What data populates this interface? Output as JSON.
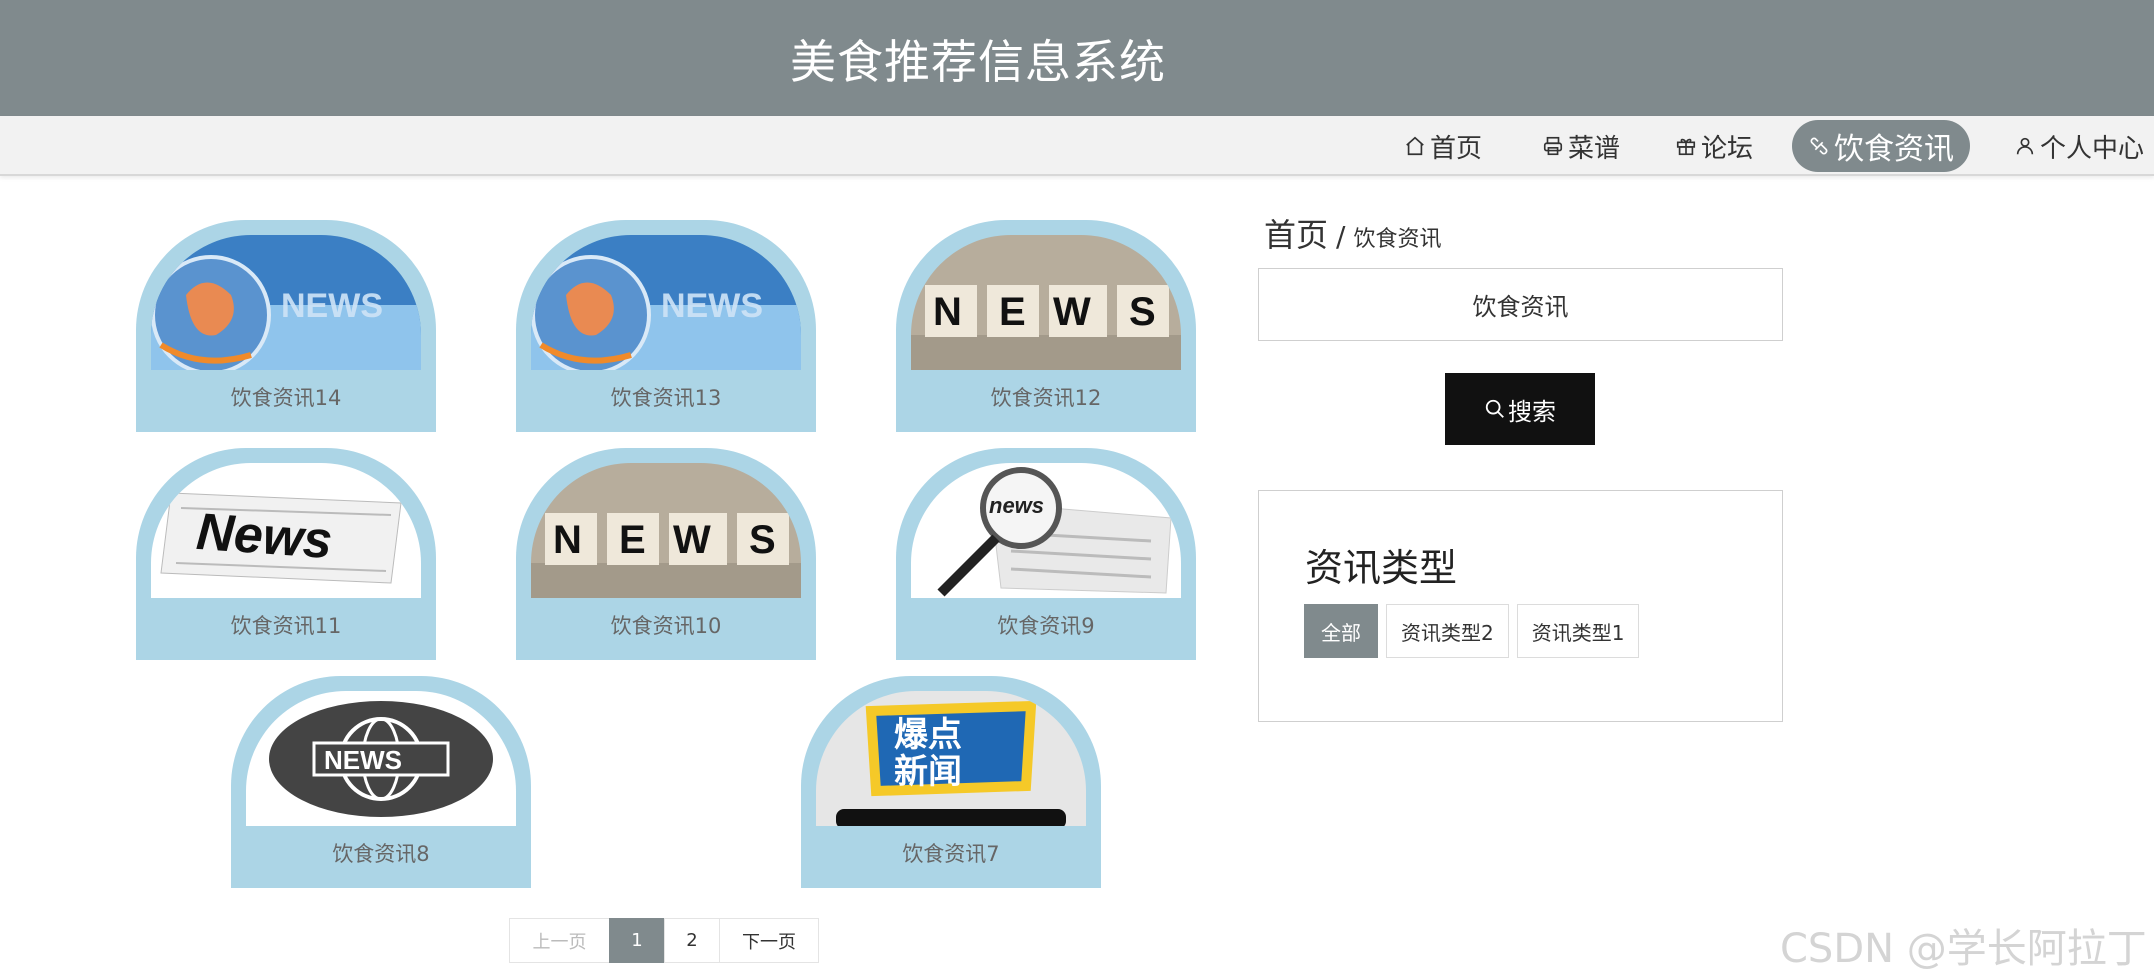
{
  "header": {
    "title": "美食推荐信息系统"
  },
  "nav": {
    "items": [
      {
        "label": "首页",
        "icon": "home-icon"
      },
      {
        "label": "菜谱",
        "icon": "printer-icon"
      },
      {
        "label": "论坛",
        "icon": "gift-icon"
      },
      {
        "label": "饮食资讯",
        "icon": "link-icon",
        "active": true
      },
      {
        "label": "个人中心",
        "icon": "user-icon"
      }
    ]
  },
  "news": {
    "items": [
      {
        "title": "饮食资讯14",
        "image": "news-globe"
      },
      {
        "title": "饮食资讯13",
        "image": "news-globe"
      },
      {
        "title": "饮食资讯12",
        "image": "news-dice"
      },
      {
        "title": "饮食资讯11",
        "image": "news-paper"
      },
      {
        "title": "饮食资讯10",
        "image": "news-dice"
      },
      {
        "title": "饮食资讯9",
        "image": "news-magnifier"
      },
      {
        "title": "饮食资讯8",
        "image": "news-world"
      },
      {
        "title": "饮食资讯7",
        "image": "news-burst"
      }
    ]
  },
  "pagination": {
    "prev": "上一页",
    "pages": [
      "1",
      "2"
    ],
    "current": "1",
    "next": "下一页"
  },
  "sidebar": {
    "breadcrumb": {
      "home": "首页",
      "separator": "/",
      "current": "饮食资讯"
    },
    "search": {
      "value": "饮食资讯",
      "button": "搜索"
    },
    "types": {
      "title": "资讯类型",
      "tags": [
        "全部",
        "资讯类型2",
        "资讯类型1"
      ],
      "active": "全部"
    }
  },
  "watermark": "CSDN @学长阿拉丁",
  "colors": {
    "header": "#808a8d",
    "card": "#acd5e6",
    "accent": "#808a8d",
    "button": "#111111"
  }
}
